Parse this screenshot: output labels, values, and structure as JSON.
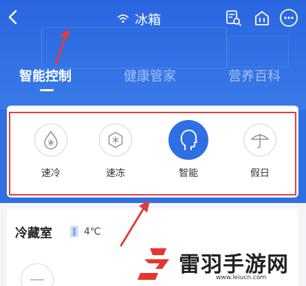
{
  "header": {
    "title": "冰箱",
    "tabs": [
      {
        "label": "智能控制",
        "active": true
      },
      {
        "label": "健康管家",
        "active": false
      },
      {
        "label": "营养百科",
        "active": false
      }
    ]
  },
  "modes": [
    {
      "label": "速冷",
      "icon": "drop-snowflake-icon",
      "active": false
    },
    {
      "label": "速冻",
      "icon": "hex-snowflake-icon",
      "active": false
    },
    {
      "label": "智能",
      "icon": "head-profile-icon",
      "active": true
    },
    {
      "label": "假日",
      "icon": "umbrella-icon",
      "active": false
    }
  ],
  "compartment": {
    "name": "冷藏室",
    "temperature": "4℃"
  },
  "watermark": {
    "text": "雷羽手游网",
    "url": "www.leiucn.com"
  },
  "colors": {
    "primary": "#2f6fe4",
    "annotation": "#e23b3b"
  }
}
